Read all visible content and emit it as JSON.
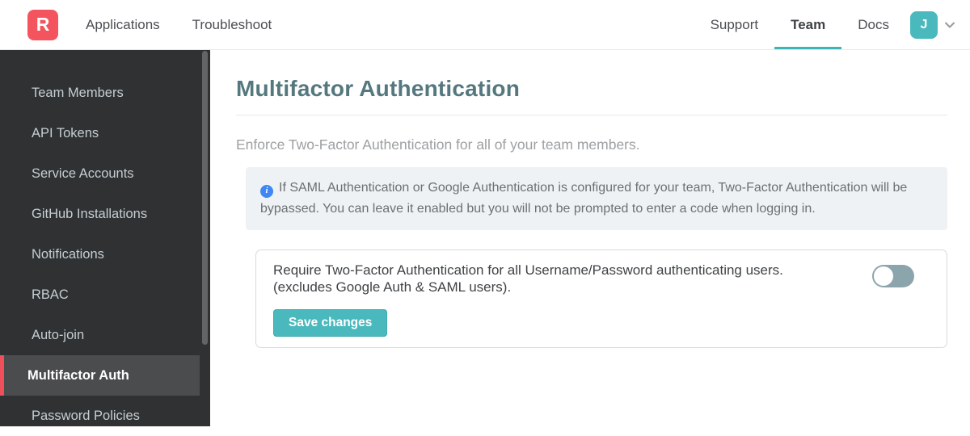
{
  "navbar": {
    "logo_letter": "R",
    "left_links": [
      {
        "label": "Applications"
      },
      {
        "label": "Troubleshoot"
      }
    ],
    "right_links": [
      {
        "label": "Support",
        "active": false
      },
      {
        "label": "Team",
        "active": true
      },
      {
        "label": "Docs",
        "active": false
      }
    ],
    "avatar_initial": "J"
  },
  "sidebar": {
    "items": [
      {
        "label": "Team Members",
        "active": false
      },
      {
        "label": "API Tokens",
        "active": false
      },
      {
        "label": "Service Accounts",
        "active": false
      },
      {
        "label": "GitHub Installations",
        "active": false
      },
      {
        "label": "Notifications",
        "active": false
      },
      {
        "label": "RBAC",
        "active": false
      },
      {
        "label": "Auto-join",
        "active": false
      },
      {
        "label": "Multifactor Auth",
        "active": true
      },
      {
        "label": "Password Policies",
        "active": false
      }
    ]
  },
  "main": {
    "title": "Multifactor Authentication",
    "description": "Enforce Two-Factor Authentication for all of your team members.",
    "info_note": "If SAML Authentication or Google Authentication is configured for your team, Two-Factor Authentication will be bypassed. You can leave it enabled but you will not be prompted to enter a code when logging in.",
    "info_icon_glyph": "i",
    "setting": {
      "label_line1": "Require Two-Factor Authentication for all Username/Password authenticating users.",
      "label_line2": "(excludes Google Auth & SAML users).",
      "toggle_state": "off",
      "save_button_label": "Save changes"
    }
  },
  "colors": {
    "brand_red": "#f4545e",
    "accent_teal": "#4ab9bd",
    "active_tab_underline": "#3db4b8",
    "heading_teal": "#55787e",
    "sidebar_bg": "#2f3133",
    "sidebar_active_bg": "#4a4c4e",
    "sidebar_active_border": "#ef4f5b",
    "info_box_bg": "#eef2f4",
    "info_icon_blue": "#4086f4",
    "toggle_track_off": "#8ca5ad"
  }
}
